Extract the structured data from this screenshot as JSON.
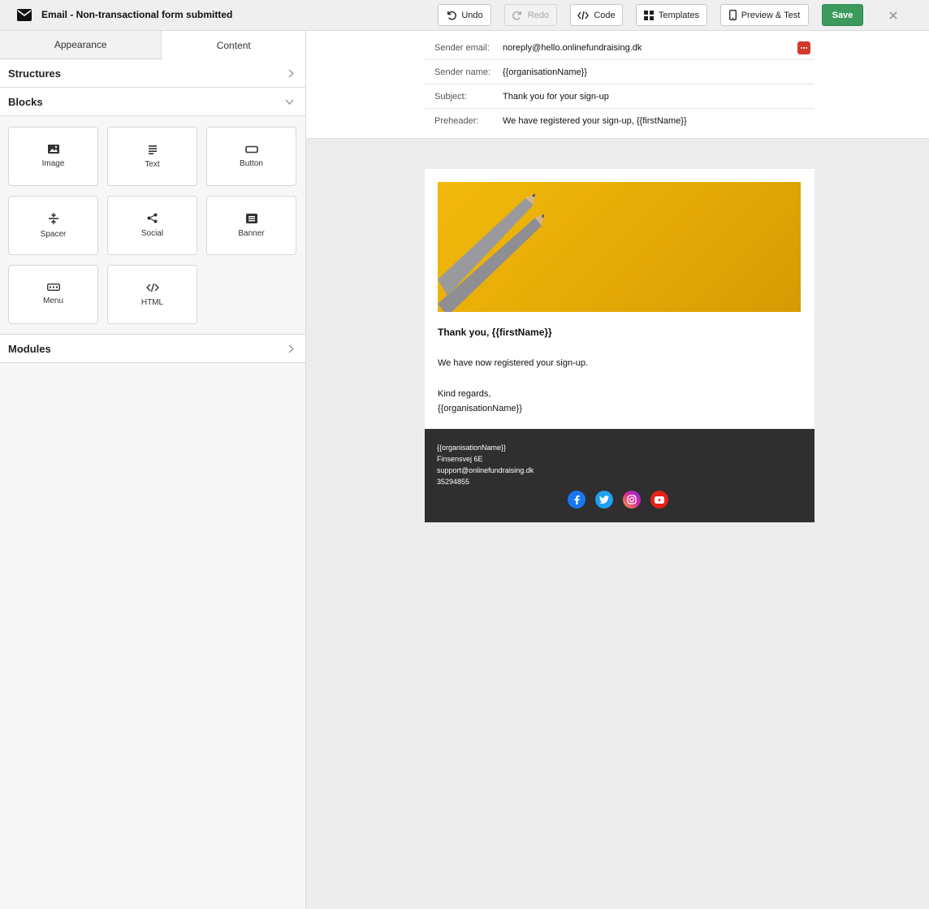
{
  "app": {
    "title": "Email - Non-transactional form submitted"
  },
  "toolbar": {
    "undo_label": "Undo",
    "redo_label": "Redo",
    "code_label": "Code",
    "templates_label": "Templates",
    "preview_label": "Preview & Test",
    "save_label": "Save",
    "save_color": "#3b9a5c"
  },
  "sidebar": {
    "tabs": [
      {
        "label": "Appearance",
        "active": false
      },
      {
        "label": "Content",
        "active": true
      }
    ],
    "sections": {
      "structures": "Structures",
      "blocks": "Blocks",
      "modules": "Modules"
    },
    "blocks": [
      {
        "label": "Image",
        "icon": "image-icon"
      },
      {
        "label": "Text",
        "icon": "text-icon"
      },
      {
        "label": "Button",
        "icon": "button-icon"
      },
      {
        "label": "Spacer",
        "icon": "spacer-icon"
      },
      {
        "label": "Social",
        "icon": "share-icon"
      },
      {
        "label": "Banner",
        "icon": "banner-icon"
      },
      {
        "label": "Menu",
        "icon": "menu-icon"
      },
      {
        "label": "HTML",
        "icon": "code-icon"
      }
    ]
  },
  "header_fields": [
    {
      "label": "Sender email:",
      "value": "noreply@hello.onlinefundraising.dk"
    },
    {
      "label": "Sender name:",
      "value": "{{organisationName}}"
    },
    {
      "label": "Subject:",
      "value": "Thank you for your sign-up"
    },
    {
      "label": "Preheader:",
      "value": "We have registered your sign-up, {{firstName}}"
    }
  ],
  "email": {
    "heading": "Thank you, {{firstName}}",
    "body": "We have now registered your sign-up.",
    "sign_off": "Kind regards,",
    "sign_name": "{{organisationName}}",
    "hero_color": "#f2b90a",
    "footer": {
      "org": "{{organisationName}}",
      "address": "Finsensvej 6E",
      "email": "support@onlinefundraising.dk",
      "phone": "35294855",
      "background": "#2f2f2f"
    },
    "socials": [
      {
        "name": "facebook-icon",
        "color": "#1877f2"
      },
      {
        "name": "twitter-icon",
        "color": "#1da1f2"
      },
      {
        "name": "instagram-icon",
        "color": "#d6249f"
      },
      {
        "name": "youtube-icon",
        "color": "#e62117"
      }
    ]
  }
}
